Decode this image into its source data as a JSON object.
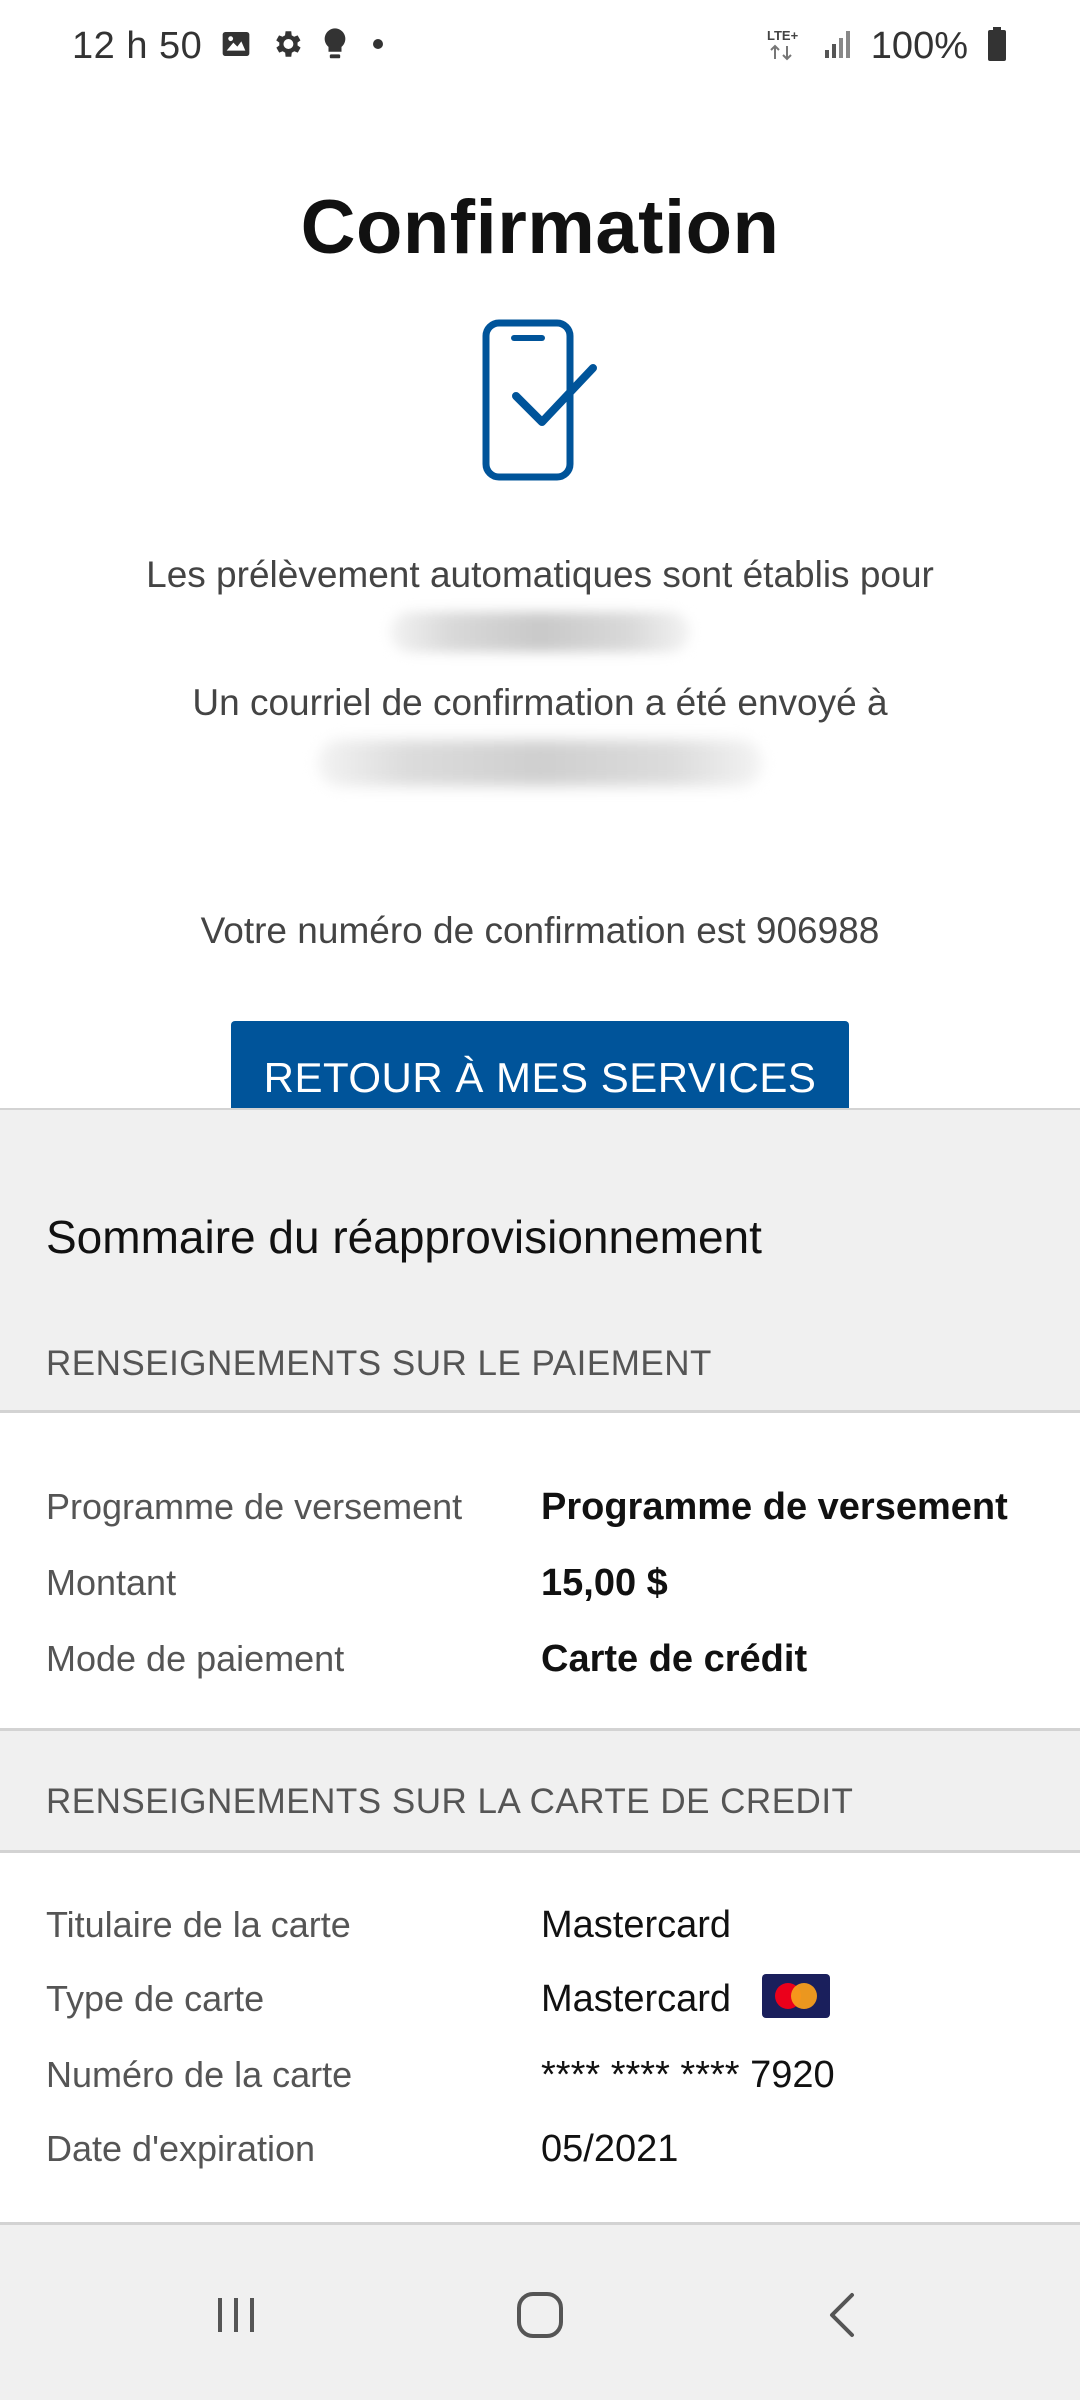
{
  "status_bar": {
    "time": "12 h 50",
    "network": "LTE+",
    "battery": "100%",
    "icons": [
      "image-icon",
      "gear-icon",
      "bulb-icon",
      "dot-icon",
      "lte-icon",
      "signal-icon",
      "battery-icon"
    ]
  },
  "confirmation": {
    "title": "Confirmation",
    "icon": "phone-check-icon",
    "message_autopay": "Les prélèvement automatiques sont établis pour",
    "message_email": "Un courriel de confirmation a été envoyé à",
    "message_number": "Votre numéro de confirmation est 906988",
    "return_button": "RETOUR À MES SERVICES"
  },
  "summary": {
    "title": "Sommaire du réapprovisionnement",
    "payment_section": {
      "header": "RENSEIGNEMENTS SUR LE PAIEMENT",
      "rows": [
        {
          "label": "Programme de versement",
          "value": "Programme de versement"
        },
        {
          "label": "Montant",
          "value": "15,00 $"
        },
        {
          "label": "Mode de paiement",
          "value": "Carte de crédit"
        }
      ]
    },
    "card_section": {
      "header": "RENSEIGNEMENTS SUR LA CARTE DE CREDIT",
      "rows": [
        {
          "label": "Titulaire de la carte",
          "value": "Mastercard"
        },
        {
          "label": "Type de carte",
          "value": "Mastercard",
          "icon": "mastercard-icon"
        },
        {
          "label": "Numéro de la carte",
          "value": "**** **** **** 7920"
        },
        {
          "label": "Date d'expiration",
          "value": "05/2021"
        }
      ]
    }
  },
  "nav_bar": {
    "buttons": [
      "recent-apps-icon",
      "home-icon",
      "back-icon"
    ]
  },
  "colors": {
    "primary": "#00549a",
    "section_bg": "#f0f0f0",
    "divider": "#d3d3d3"
  }
}
